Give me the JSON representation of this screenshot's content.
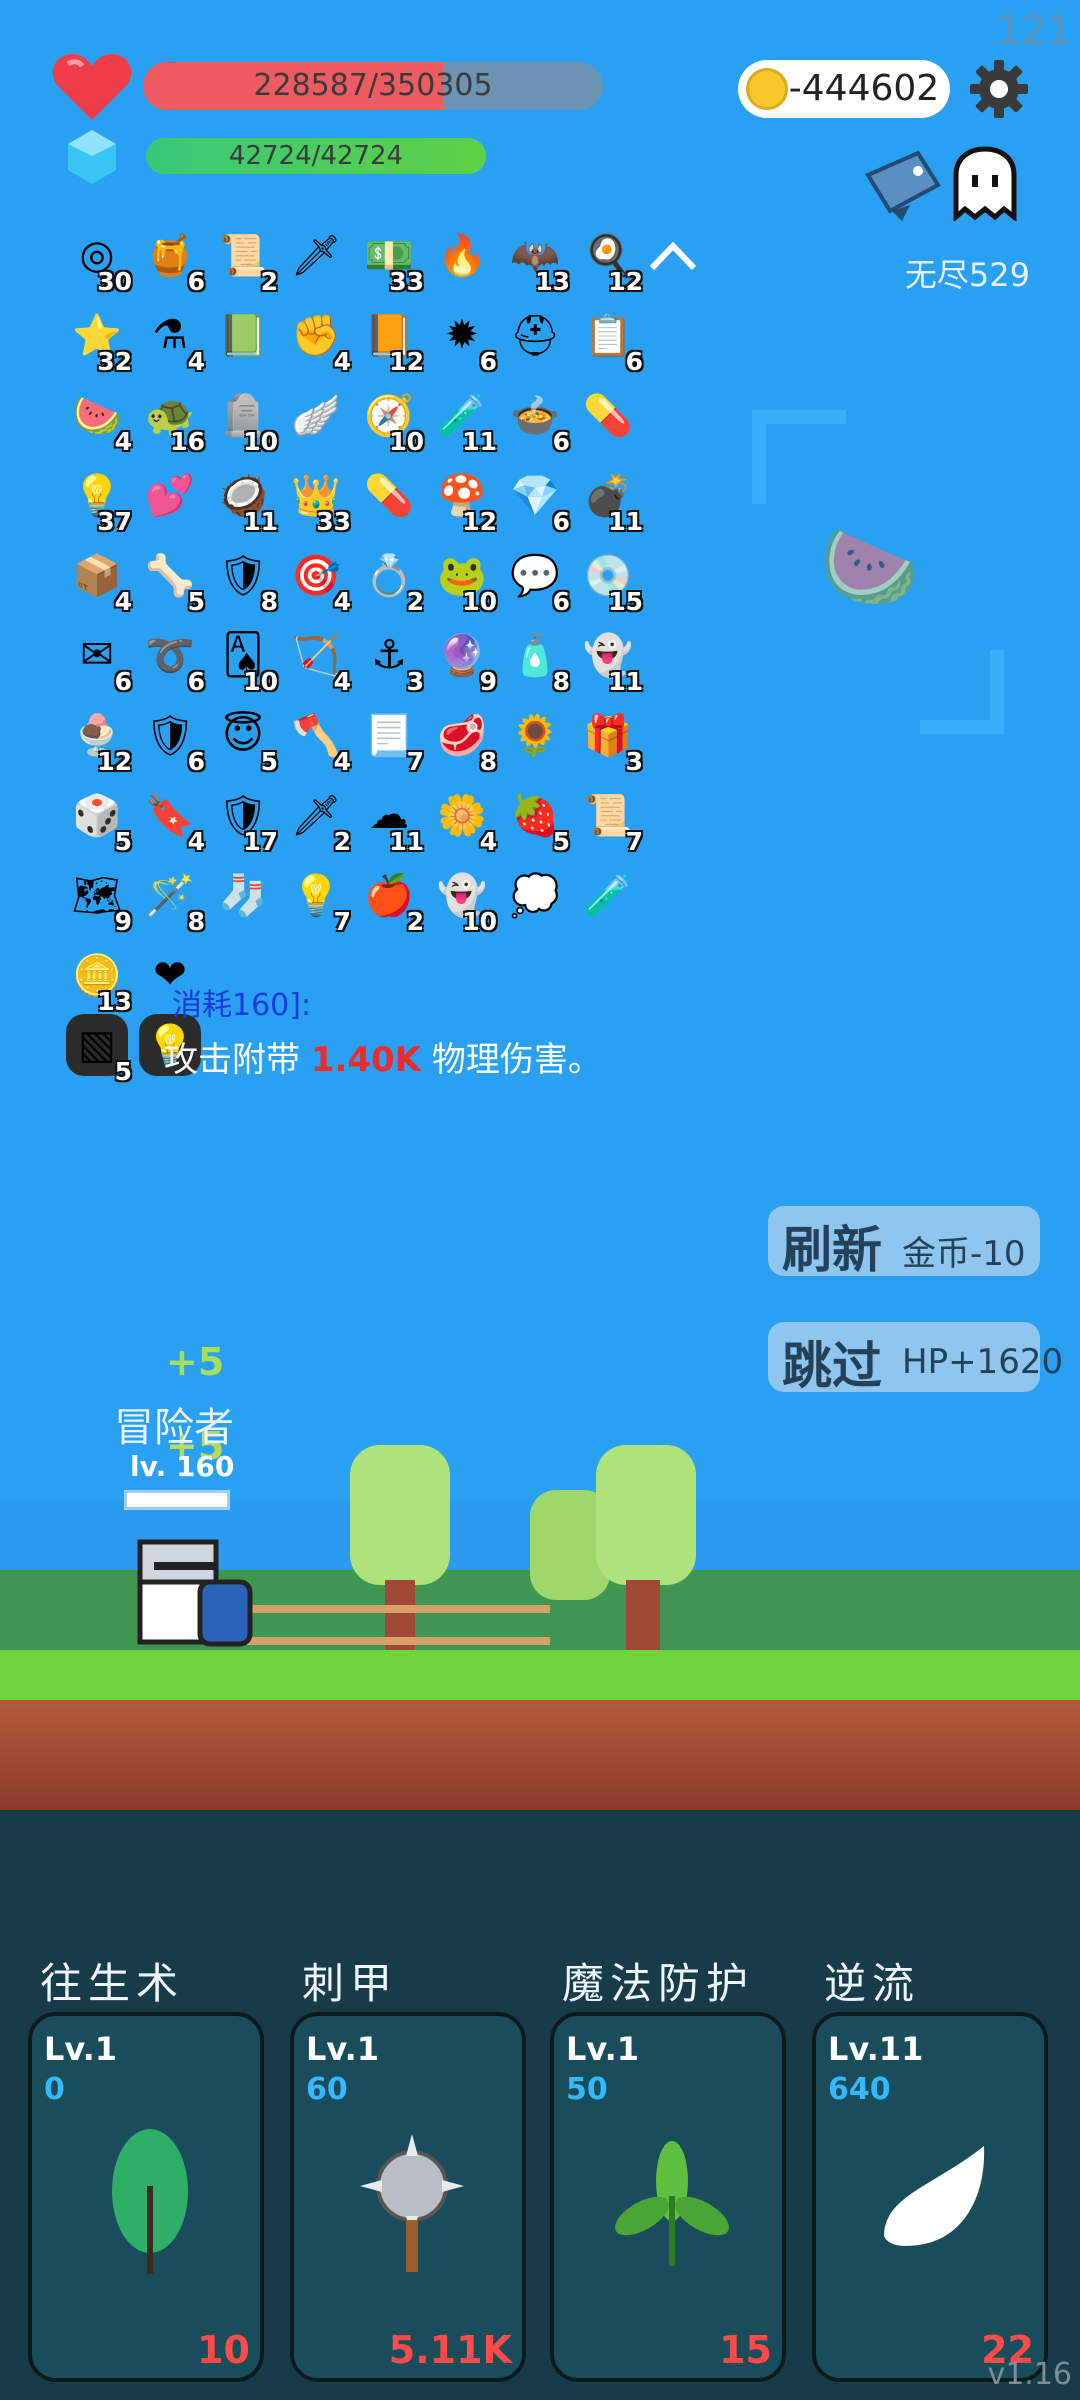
{
  "fps": "121",
  "hp": {
    "text": "228587/350305",
    "fraction": 0.6526
  },
  "mp": {
    "text": "42724/42724",
    "fraction": 1.0
  },
  "coins": "-444602",
  "endless_label": "无尽529",
  "colors": {
    "hp": "#ee5b62",
    "mp": "#36c97a",
    "sky": "#2aa0f2",
    "cost": "#ff4a4a",
    "skill_value": "#35b8ff"
  },
  "items": [
    {
      "icon": "shield-round-icon",
      "glyph": "◎",
      "count": "30"
    },
    {
      "icon": "jam-jar-icon",
      "glyph": "🍯",
      "count": "6"
    },
    {
      "icon": "scroll-icon",
      "glyph": "📜",
      "count": "2"
    },
    {
      "icon": "sword-icon",
      "glyph": "🗡",
      "count": ""
    },
    {
      "icon": "money-heart-icon",
      "glyph": "💵",
      "count": "33"
    },
    {
      "icon": "torch-icon",
      "glyph": "🔥",
      "count": ""
    },
    {
      "icon": "bat-icon",
      "glyph": "🦇",
      "count": "13"
    },
    {
      "icon": "fried-egg-icon",
      "glyph": "🍳",
      "count": "12"
    },
    {
      "icon": "star-card-icon",
      "glyph": "⭐",
      "count": "32"
    },
    {
      "icon": "potion-brown-icon",
      "glyph": "⚗",
      "count": "4"
    },
    {
      "icon": "green-book-icon",
      "glyph": "📗",
      "count": ""
    },
    {
      "icon": "fist-icon",
      "glyph": "✊",
      "count": "4"
    },
    {
      "icon": "orange-book-icon",
      "glyph": "📙",
      "count": "12"
    },
    {
      "icon": "mace-icon",
      "glyph": "✹",
      "count": "6"
    },
    {
      "icon": "viking-helmet-icon",
      "glyph": "⛑",
      "count": ""
    },
    {
      "icon": "clipboard-icon",
      "glyph": "📋",
      "count": "6"
    },
    {
      "icon": "watermelon-icon",
      "glyph": "🍉",
      "count": "4"
    },
    {
      "icon": "turtle-shell-icon",
      "glyph": "🐢",
      "count": "16"
    },
    {
      "icon": "tombstone-icon",
      "glyph": "🪦",
      "count": "10"
    },
    {
      "icon": "wing-icon",
      "glyph": "🪽",
      "count": ""
    },
    {
      "icon": "compass-icon",
      "glyph": "🧭",
      "count": "10"
    },
    {
      "icon": "flask-icon",
      "glyph": "🧪",
      "count": "11"
    },
    {
      "icon": "cauldron-icon",
      "glyph": "🍲",
      "count": "6"
    },
    {
      "icon": "pill-blue-icon",
      "glyph": "💊",
      "count": ""
    },
    {
      "icon": "bulb-icon",
      "glyph": "💡",
      "count": "37"
    },
    {
      "icon": "hearts-icon",
      "glyph": "💕",
      "count": ""
    },
    {
      "icon": "coconut-icon",
      "glyph": "🥥",
      "count": "11"
    },
    {
      "icon": "crown-icon",
      "glyph": "👑",
      "count": "33"
    },
    {
      "icon": "pill-red-icon",
      "glyph": "💊",
      "count": ""
    },
    {
      "icon": "mushroom-icon",
      "glyph": "🍄",
      "count": "12"
    },
    {
      "icon": "sapphire-icon",
      "glyph": "💎",
      "count": "6"
    },
    {
      "icon": "grenade-icon",
      "glyph": "💣",
      "count": "11"
    },
    {
      "icon": "purple-box-icon",
      "glyph": "📦",
      "count": "4"
    },
    {
      "icon": "bones-icon",
      "glyph": "🦴",
      "count": "5"
    },
    {
      "icon": "shield-red-icon",
      "glyph": "🛡",
      "count": "8"
    },
    {
      "icon": "target-icon",
      "glyph": "🎯",
      "count": "4"
    },
    {
      "icon": "ring-icon",
      "glyph": "💍",
      "count": "2"
    },
    {
      "icon": "frog-icon",
      "glyph": "🐸",
      "count": "10"
    },
    {
      "icon": "speech-bubble-icon",
      "glyph": "💬",
      "count": "6"
    },
    {
      "icon": "disc-icon",
      "glyph": "💿",
      "count": "15"
    },
    {
      "icon": "envelope-icon",
      "glyph": "✉",
      "count": "6"
    },
    {
      "icon": "noose-icon",
      "glyph": "➰",
      "count": "6"
    },
    {
      "icon": "playing-card-icon",
      "glyph": "🂡",
      "count": "10"
    },
    {
      "icon": "bow-icon",
      "glyph": "🏹",
      "count": "4"
    },
    {
      "icon": "hook-icon",
      "glyph": "⚓",
      "count": "3"
    },
    {
      "icon": "crystal-ball-icon",
      "glyph": "🔮",
      "count": "9"
    },
    {
      "icon": "perfume-icon",
      "glyph": "🧴",
      "count": "8"
    },
    {
      "icon": "green-spirit-icon",
      "glyph": "👻",
      "count": "11"
    },
    {
      "icon": "ice-cream-icon",
      "glyph": "🍨",
      "count": "12"
    },
    {
      "icon": "shield-purple-icon",
      "glyph": "🛡",
      "count": "6"
    },
    {
      "icon": "halo-icon",
      "glyph": "😇",
      "count": "5"
    },
    {
      "icon": "axe-icon",
      "glyph": "🪓",
      "count": "4"
    },
    {
      "icon": "blue-scroll-icon",
      "glyph": "📃",
      "count": "7"
    },
    {
      "icon": "steak-icon",
      "glyph": "🥩",
      "count": "8"
    },
    {
      "icon": "sunflower-icon",
      "glyph": "🌻",
      "count": ""
    },
    {
      "icon": "gift-icon",
      "glyph": "🎁",
      "count": "3"
    },
    {
      "icon": "dice-icon",
      "glyph": "🎲",
      "count": "5"
    },
    {
      "icon": "bookmark-icon",
      "glyph": "🔖",
      "count": "4"
    },
    {
      "icon": "blue-shield-icon",
      "glyph": "🛡",
      "count": "17"
    },
    {
      "icon": "dagger-icon",
      "glyph": "🗡",
      "count": "2"
    },
    {
      "icon": "cloud-icon",
      "glyph": "☁",
      "count": "11"
    },
    {
      "icon": "flower-icon",
      "glyph": "🌼",
      "count": "4"
    },
    {
      "icon": "strawberry-icon",
      "glyph": "🍓",
      "count": "5"
    },
    {
      "icon": "orange-scroll-icon",
      "glyph": "📜",
      "count": "7"
    },
    {
      "icon": "map-icon",
      "glyph": "🗺",
      "count": "9"
    },
    {
      "icon": "magic-wand-icon",
      "glyph": "🪄",
      "count": "8"
    },
    {
      "icon": "sock-icon",
      "glyph": "🧦",
      "count": ""
    },
    {
      "icon": "lightbulb-icon",
      "glyph": "💡",
      "count": "7"
    },
    {
      "icon": "apple-icon",
      "glyph": "🍎",
      "count": "2"
    },
    {
      "icon": "ghost-skull-icon",
      "glyph": "👻",
      "count": "10"
    },
    {
      "icon": "chat-bubble-icon",
      "glyph": "💭",
      "count": ""
    },
    {
      "icon": "potion-blue-icon",
      "glyph": "🧪",
      "count": ""
    },
    {
      "icon": "coin-stack-icon",
      "glyph": "🪙",
      "count": "13"
    },
    {
      "icon": "big-heart-icon",
      "glyph": "❤",
      "count": ""
    }
  ],
  "extra_items": [
    {
      "icon": "metal-crate-icon",
      "glyph": "▧",
      "count": "5"
    },
    {
      "icon": "light-box-icon",
      "glyph": "💡",
      "count": ""
    }
  ],
  "tooltip": {
    "cost": "消耗160]:",
    "desc_prefix": "攻击附带 ",
    "desc_value": "1.40K",
    "desc_suffix": " 物理伤害。"
  },
  "buttons": {
    "refresh": {
      "label": "刷新",
      "sub": "金币-10"
    },
    "skip": {
      "label": "跳过",
      "sub": "HP+1620"
    }
  },
  "floating": {
    "plus1": "+5",
    "plus2": "+5"
  },
  "hero": {
    "name": "冒险者",
    "level": "lv. 160"
  },
  "skills": [
    {
      "name": "往生术",
      "level": "Lv.1",
      "value": "0",
      "cost": "10",
      "icon": "leaf-icon"
    },
    {
      "name": "刺甲",
      "level": "Lv.1",
      "value": "60",
      "cost": "5.11K",
      "icon": "spiked-ball-icon"
    },
    {
      "name": "魔法防护",
      "level": "Lv.1",
      "value": "50",
      "cost": "15",
      "icon": "herb-icon"
    },
    {
      "name": "逆流",
      "level": "Lv.11",
      "value": "640",
      "cost": "22",
      "icon": "white-wing-icon"
    }
  ],
  "version": "v1.16"
}
